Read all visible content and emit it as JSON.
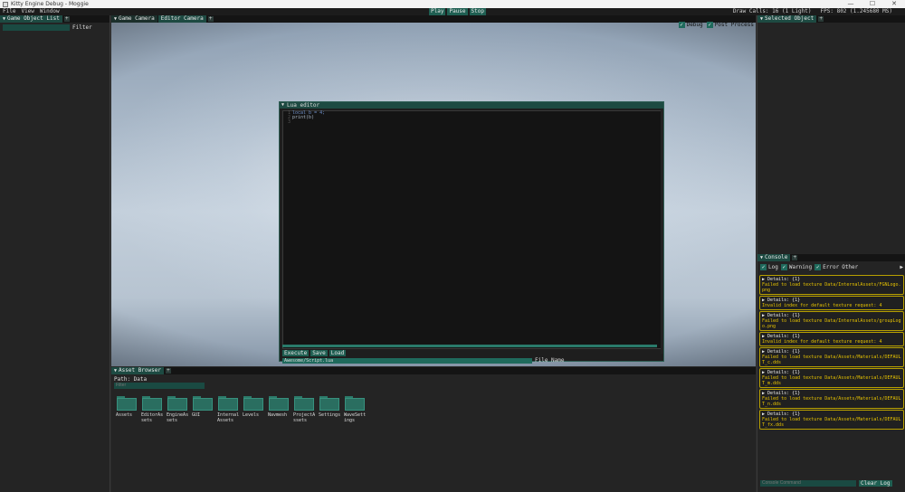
{
  "window": {
    "title": "Kitty Engine Debug - Moggie",
    "controls": [
      "—",
      "☐",
      "✕"
    ]
  },
  "menu": {
    "items": [
      "File",
      "View",
      "Window"
    ]
  },
  "playback": {
    "play": "Play",
    "pause": "Pause",
    "stop": "Stop"
  },
  "stats": {
    "draw_calls": "Draw Calls: 16 (1 Light)",
    "fps": "FPS: 802 (1.245680 MS)"
  },
  "left_panel": {
    "tab": "Game Object List",
    "filter_label": "Filter",
    "filter_value": ""
  },
  "viewport": {
    "tabs": [
      "Game Camera",
      "Editor Camera"
    ],
    "debug_label": "Debug",
    "post_process_label": "Post Process"
  },
  "lua_editor": {
    "title": "Lua editor",
    "code_lines": [
      {
        "num": "1",
        "code": "local b = 4;"
      },
      {
        "num": "2",
        "code": "print(b)"
      },
      {
        "num": "3",
        "code": ""
      }
    ],
    "execute": "Execute",
    "save": "Save",
    "load": "Load",
    "script_path": "Awesome/Script.lua",
    "file_name_label": "File Name"
  },
  "asset_browser": {
    "tab": "Asset Browser",
    "path": "Path: Data",
    "filter_placeholder": "Filter",
    "folders": [
      "Assets",
      "EditorAssets",
      "EngineAssets",
      "GUI",
      "InternalAssets",
      "Levels",
      "Navmesh",
      "ProjectAssets",
      "Settings",
      "WaveSettings"
    ]
  },
  "selected_object": {
    "tab": "Selected Object"
  },
  "console": {
    "tab": "Console",
    "filters": {
      "log": "Log",
      "warning": "Warning",
      "error": "Error",
      "other": "Other"
    },
    "entries": [
      {
        "details": "▶ Details: {1}",
        "message": "Failed to load texture Data/InternalAssets/FGNLogo.png"
      },
      {
        "details": "▶ Details: {1}",
        "message": "Invalid index for default texture request: 4"
      },
      {
        "details": "▶ Details: {1}",
        "message": "Failed to load texture Data/InternalAssets/groupLogo.png"
      },
      {
        "details": "▶ Details: {1}",
        "message": "Invalid index for default texture request: 4"
      },
      {
        "details": "▶ Details: {1}",
        "message": "Failed to load texture Data/Assets/Materials/DEFAULT_c.dds"
      },
      {
        "details": "▶ Details: {1}",
        "message": "Failed to load texture Data/Assets/Materials/DEFAULT_m.dds"
      },
      {
        "details": "▶ Details: {1}",
        "message": "Failed to load texture Data/Assets/Materials/DEFAULT_n.dds"
      },
      {
        "details": "▶ Details: {1}",
        "message": "Failed to load texture Data/Assets/Materials/DEFAULT_fx.dds"
      }
    ],
    "command_placeholder": "Console Command",
    "clear_log": "Clear Log"
  },
  "colors": {
    "accent": "#1f5f52",
    "tab": "#1d4a42",
    "warning_border": "#b8a000",
    "warning_text": "#e6c200"
  }
}
